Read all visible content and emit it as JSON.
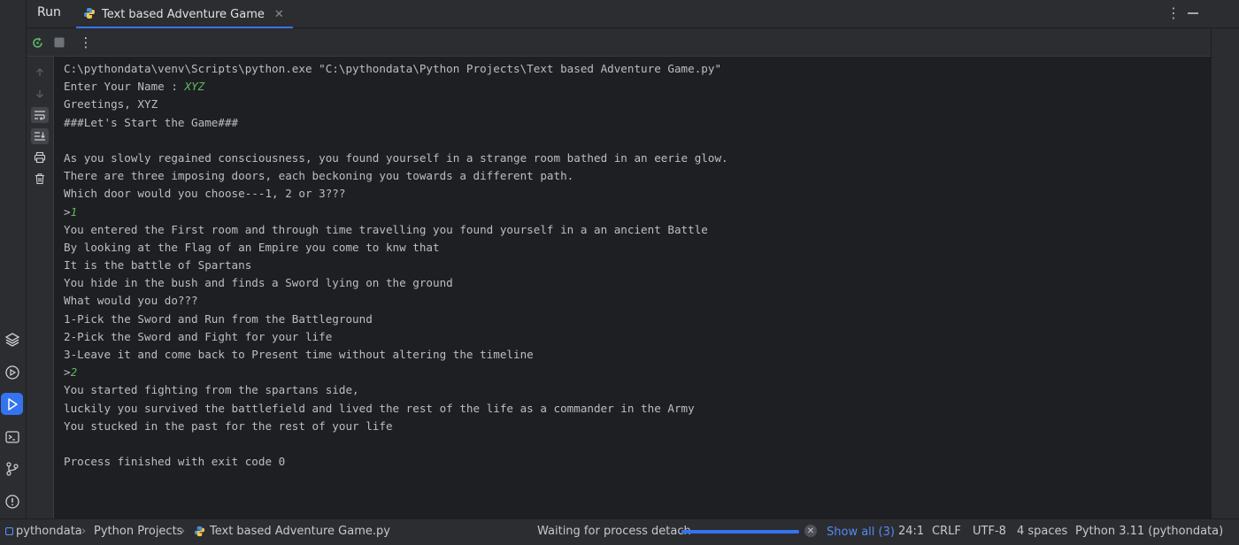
{
  "header": {
    "title": "Run",
    "tab": {
      "label": "Text based Adventure Game",
      "icon": "python-file-icon",
      "close_icon": "close-icon"
    },
    "more_icon": "more-vertical-icon",
    "minimize_icon": "minimize-icon"
  },
  "toolbar": {
    "rerun_icon": "rerun-icon",
    "stop_icon": "stop-icon",
    "more_icon": "more-vertical-icon"
  },
  "console_side": [
    "up-arrow-icon",
    "down-arrow-icon",
    "soft-wrap-icon",
    "scroll-to-end-icon",
    "print-icon",
    "trash-icon"
  ],
  "console": {
    "lines": [
      {
        "text": "C:\\pythondata\\venv\\Scripts\\python.exe \"C:\\pythondata\\Python Projects\\Text based Adventure Game.py\""
      },
      {
        "text": "Enter Your Name : ",
        "input": "XYZ"
      },
      {
        "text": "Greetings, XYZ"
      },
      {
        "text": "###Let's Start the Game###"
      },
      {
        "text": ""
      },
      {
        "text": "As you slowly regained consciousness, you found yourself in a strange room bathed in an eerie glow."
      },
      {
        "text": "There are three imposing doors, each beckoning you towards a different path."
      },
      {
        "text": "Which door would you choose---1, 2 or 3???"
      },
      {
        "text": ">",
        "input": "1"
      },
      {
        "text": "You entered the First room and through time travelling you found yourself in a an ancient Battle"
      },
      {
        "text": "By looking at the Flag of an Empire you come to knw that"
      },
      {
        "text": "It is the battle of Spartans"
      },
      {
        "text": "You hide in the bush and finds a Sword lying on the ground"
      },
      {
        "text": "What would you do???"
      },
      {
        "text": "1-Pick the Sword and Run from the Battleground"
      },
      {
        "text": "2-Pick the Sword and Fight for your life"
      },
      {
        "text": "3-Leave it and come back to Present time without altering the timeline"
      },
      {
        "text": ">",
        "input": "2"
      },
      {
        "text": "You started fighting from the spartans side,"
      },
      {
        "text": "luckily you survived the battlefield and lived the rest of the life as a commander in the Army"
      },
      {
        "text": "You stucked in the past for the rest of your life"
      },
      {
        "text": ""
      },
      {
        "text": "Process finished with exit code 0"
      }
    ]
  },
  "activity_bar": [
    "layers-icon",
    "services-icon",
    "run-icon",
    "terminal-icon",
    "git-branch-icon",
    "problems-icon"
  ],
  "status_bar": {
    "breadcrumb": [
      "pythondata",
      "Python Projects",
      "Text based Adventure Game.py"
    ],
    "process_text": "Waiting for process detach",
    "progress": 1.0,
    "show_all": "Show all (3)",
    "position": "24:1",
    "line_separator": "CRLF",
    "encoding": "UTF-8",
    "indent": "4 spaces",
    "interpreter": "Python 3.11 (pythondata)"
  },
  "colors": {
    "accent": "#3574f0",
    "input_text": "#5fb865",
    "console_text": "#bcbec4",
    "background": "#1e1f22",
    "panel": "#2b2d30"
  }
}
